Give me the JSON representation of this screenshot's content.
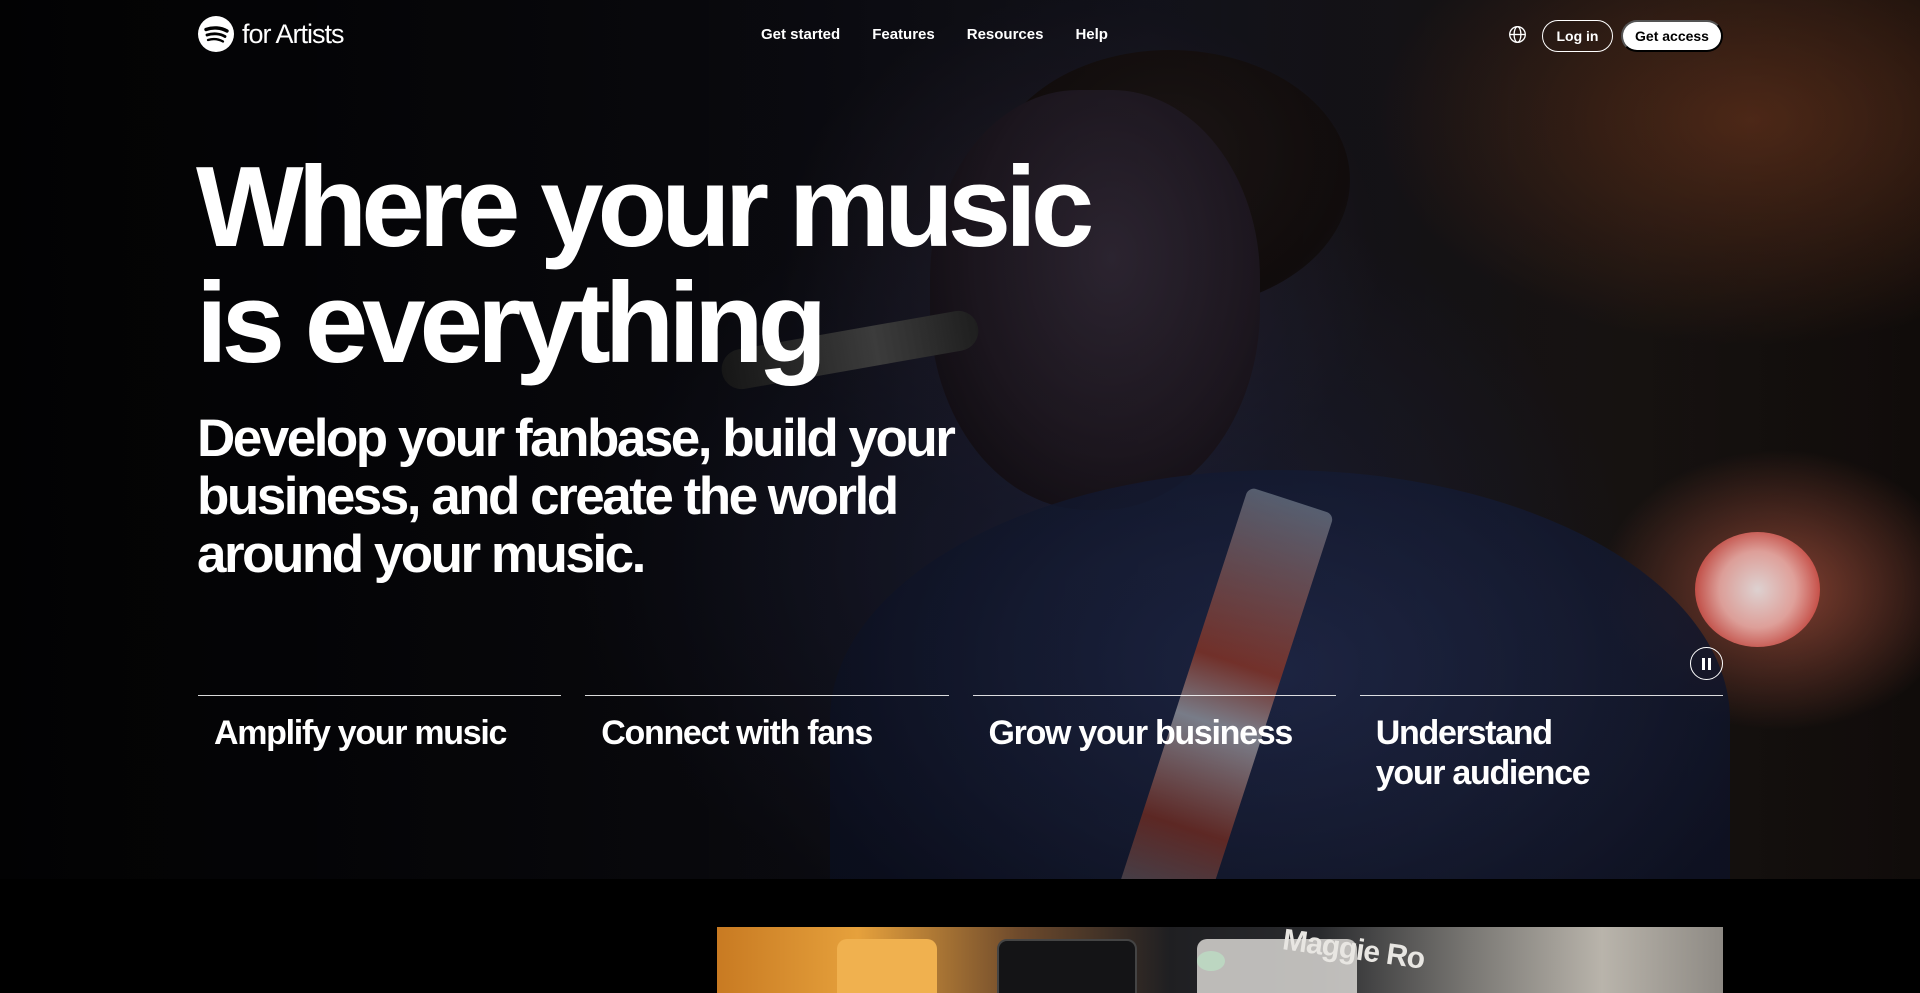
{
  "brand": {
    "logo_text": "for Artists",
    "accent": "#1ed760"
  },
  "nav": {
    "links": [
      "Get started",
      "Features",
      "Resources",
      "Help"
    ],
    "login_label": "Log in",
    "access_label": "Get access",
    "language_icon": "globe-icon"
  },
  "hero": {
    "headline": "Where your music is everything",
    "subhead": "Develop your fanbase, build your business, and create the world around your music.",
    "video_control_icon": "pause-icon"
  },
  "features": [
    "Amplify your music",
    "Connect with fans",
    "Grow your business",
    "Understand\nyour audience"
  ],
  "preview": {
    "visible_text": "Maggie Ro"
  }
}
